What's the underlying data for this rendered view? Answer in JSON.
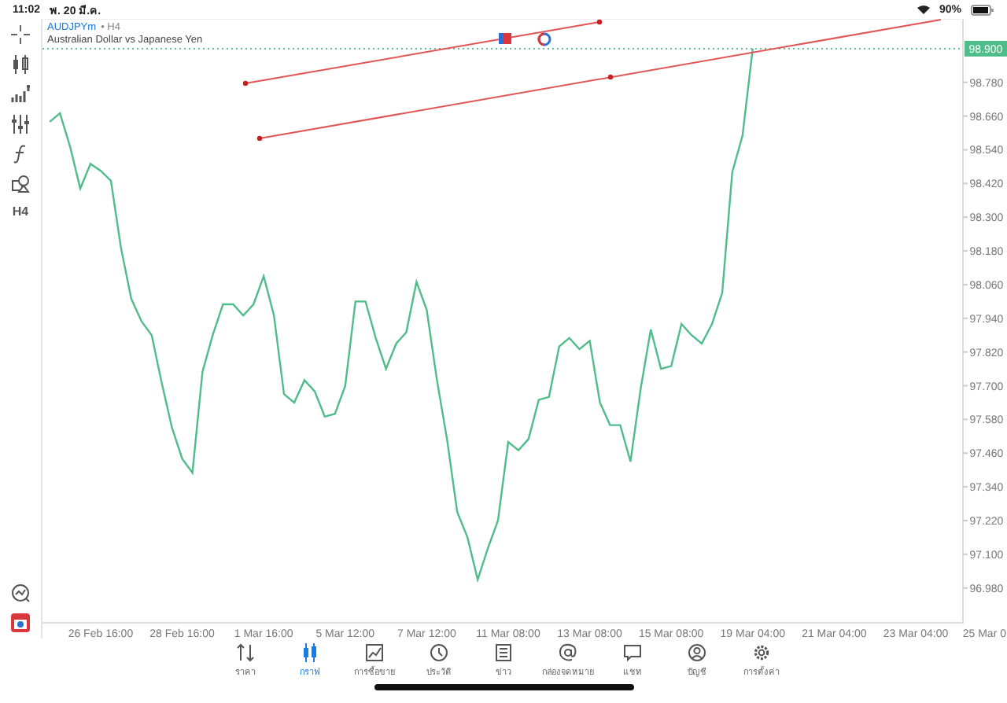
{
  "status_bar": {
    "time": "11:02",
    "date": "พ. 20 มี.ค.",
    "battery": "90%"
  },
  "symbol": {
    "name": "AUDJPYm",
    "timeframe": "• H4",
    "description": "Australian Dollar vs Japanese Yen"
  },
  "toolbar": {
    "timeframe": "H4"
  },
  "chart": {
    "chart_data": {
      "type": "line",
      "ylim": [
        96.856,
        99.006
      ],
      "ref_lines": [
        {
          "axis": "y",
          "value": 98.9,
          "label": "98.900",
          "color": "#4fbd8a"
        }
      ],
      "categories": [
        null,
        null,
        null,
        null,
        null,
        "26 Feb 16:00",
        null,
        null,
        null,
        null,
        null,
        null,
        null,
        "28 Feb 16:00",
        null,
        null,
        null,
        null,
        null,
        null,
        null,
        "1 Mar 16:00",
        null,
        null,
        null,
        null,
        null,
        null,
        null,
        "5 Mar 12:00",
        null,
        null,
        null,
        null,
        null,
        null,
        null,
        "7 Mar 12:00",
        null,
        null,
        null,
        null,
        null,
        null,
        null,
        "11 Mar 08:00",
        null,
        null,
        null,
        null,
        null,
        null,
        null,
        "13 Mar 08:00",
        null,
        null,
        null,
        null,
        null,
        null,
        null,
        "15 Mar 08:00",
        null,
        null,
        null,
        null,
        null,
        null,
        null,
        "19 Mar 04:00",
        null,
        null,
        null,
        null,
        null,
        null,
        null,
        "21 Mar 04:00",
        null,
        null,
        null,
        null,
        null,
        null,
        null,
        "23 Mar 04:00",
        null,
        null,
        null,
        null,
        null,
        null,
        null,
        "25 Mar 0"
      ],
      "series": [
        {
          "color": "#4fbd8a",
          "values": [
            98.64,
            98.67,
            98.55,
            98.402,
            98.49,
            98.465,
            98.43,
            98.19,
            98.01,
            97.93,
            97.88,
            97.71,
            97.55,
            97.44,
            97.39,
            97.75,
            97.88,
            97.99,
            97.99,
            97.95,
            97.99,
            98.09,
            97.95,
            97.67,
            97.64,
            97.72,
            97.68,
            97.59,
            97.6,
            97.7,
            98.0,
            98.0,
            97.87,
            97.76,
            97.85,
            97.89,
            98.07,
            97.97,
            97.72,
            97.51,
            97.25,
            97.16,
            97.01,
            97.12,
            97.22,
            97.5,
            97.47,
            97.51,
            97.65,
            97.66,
            97.84,
            97.87,
            97.83,
            97.86,
            97.64,
            97.56,
            97.56,
            97.43,
            97.69,
            97.9,
            97.76,
            97.77,
            97.92,
            97.88,
            97.85,
            97.92,
            98.03,
            98.46,
            98.59,
            98.9,
            null,
            null,
            null,
            null,
            null,
            null,
            null,
            null,
            null,
            null,
            null,
            null,
            null,
            null,
            null,
            null,
            null,
            null,
            null,
            null,
            null,
            null,
            null,
            null
          ]
        }
      ],
      "yticks": [
        {
          "value": 98.78,
          "label": "98.780"
        },
        {
          "value": 98.66,
          "label": "98.660"
        },
        {
          "value": 98.54,
          "label": "98.540"
        },
        {
          "value": 98.42,
          "label": "98.420"
        },
        {
          "value": 98.3,
          "label": "98.300"
        },
        {
          "value": 98.18,
          "label": "98.180"
        },
        {
          "value": 98.06,
          "label": "98.060"
        },
        {
          "value": 97.94,
          "label": "97.940"
        },
        {
          "value": 97.82,
          "label": "97.820"
        },
        {
          "value": 97.7,
          "label": "97.700"
        },
        {
          "value": 97.58,
          "label": "97.580"
        },
        {
          "value": 97.46,
          "label": "97.460"
        },
        {
          "value": 97.34,
          "label": "97.340"
        },
        {
          "value": 97.22,
          "label": "97.220"
        },
        {
          "value": 97.1,
          "label": "97.100"
        },
        {
          "value": 96.98,
          "label": "96.980"
        }
      ]
    }
  },
  "tabs": [
    {
      "kind": "quotes",
      "label": "ราคา",
      "selected": false
    },
    {
      "kind": "chart",
      "label": "กราฟ",
      "selected": true
    },
    {
      "kind": "trade",
      "label": "การซื้อขาย",
      "selected": false
    },
    {
      "kind": "history",
      "label": "ประวัติ",
      "selected": false
    },
    {
      "kind": "news",
      "label": "ข่าว",
      "selected": false
    },
    {
      "kind": "mail",
      "label": "กล่องจดหมาย",
      "selected": false
    },
    {
      "kind": "chat",
      "label": "แชท",
      "selected": false
    },
    {
      "kind": "account",
      "label": "บัญชี",
      "selected": false
    },
    {
      "kind": "settings",
      "label": "การตั้งค่า",
      "selected": false
    }
  ]
}
